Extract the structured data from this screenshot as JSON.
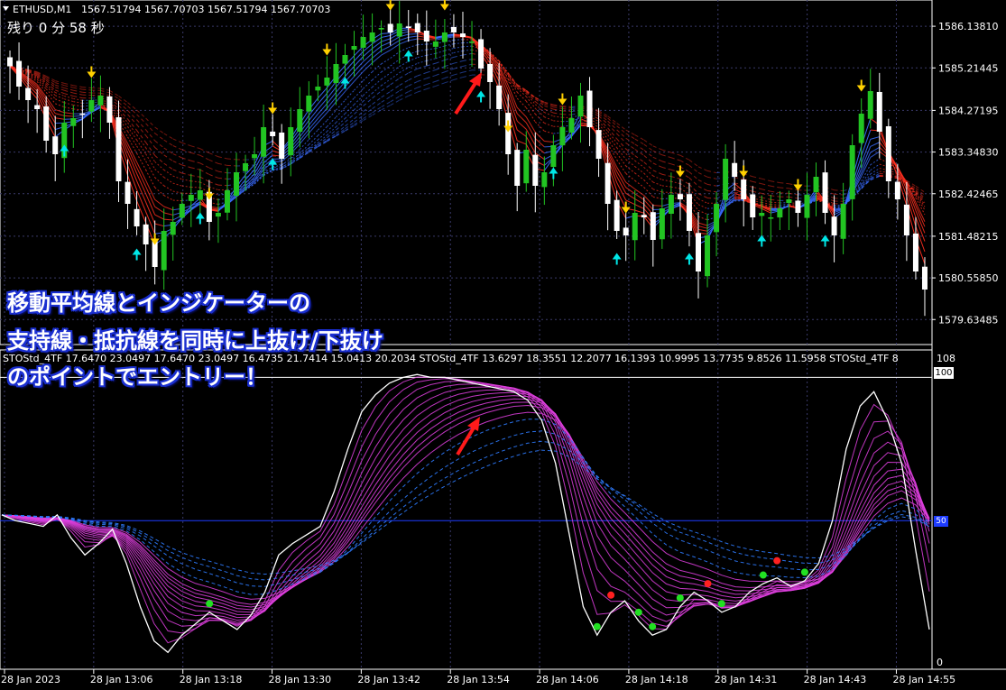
{
  "header": {
    "symbol": "ETHUSD,M1",
    "ohlc": "1567.51794 1567.70703 1567.51794 1567.70703",
    "timer_text": "残り 0 分 58 秒",
    "menu_arrow_icon": "triangle-down-icon"
  },
  "price_axis": {
    "labels": [
      "1586.13810",
      "1585.21445",
      "1584.27195",
      "1583.34830",
      "1582.42465",
      "1581.48215",
      "1580.55850",
      "1579.63485"
    ]
  },
  "indicator": {
    "header_text": "STOStd_4TF 17.6470 23.0497 17.6470 23.0497 16.4735 21.7414 15.0413 20.2034  STOStd_4TF 13.6297 18.3551 12.2077 16.1393 10.9995 13.7735 9.8526 11.5958  STOStd_4TF 8",
    "axis_top": "108",
    "level_100": "100",
    "level_mid": "50",
    "level_0": "0"
  },
  "time_axis": {
    "labels": [
      "28 Jan 2023",
      "28 Jan 13:06",
      "28 Jan 13:18",
      "28 Jan 13:30",
      "28 Jan 13:42",
      "28 Jan 13:54",
      "28 Jan 14:06",
      "28 Jan 14:18",
      "28 Jan 14:31",
      "28 Jan 14:43",
      "28 Jan 14:55"
    ]
  },
  "annotation": {
    "line1": "移動平均線とインジケーターの",
    "line2": "支持線・抵抗線を同時に上抜け/下抜け",
    "line3": "のポイントでエントリー！"
  },
  "colors": {
    "background": "#000000",
    "bull_candle": "#22c422",
    "bear_candle": "#ffffff",
    "ma_up": "#3a6cff",
    "ma_down": "#ff3020",
    "osc_main": "#ffffff",
    "osc_fan": "#e040e0",
    "buy_arrow": "#00e6e6",
    "sell_arrow": "#ffd000",
    "annotation_arrow": "#ff1a1a"
  },
  "chart_data": {
    "type": "candlestick",
    "symbol": "ETHUSD,M1",
    "x_labels": [
      "28 Jan 2023",
      "28 Jan 13:06",
      "28 Jan 13:18",
      "28 Jan 13:30",
      "28 Jan 13:42",
      "28 Jan 13:54",
      "28 Jan 14:06",
      "28 Jan 14:18",
      "28 Jan 14:31",
      "28 Jan 14:43",
      "28 Jan 14:55"
    ],
    "y_range_price": [
      1579.2,
      1586.6
    ],
    "close_prices": [
      1585.25,
      1584.8,
      1584.5,
      1584.3,
      1583.6,
      1583.3,
      1584.0,
      1584.1,
      1584.2,
      1584.5,
      1584.6,
      1584.0,
      1582.7,
      1582.2,
      1581.7,
      1581.3,
      1580.8,
      1581.6,
      1581.8,
      1582.2,
      1582.4,
      1582.5,
      1581.8,
      1582.0,
      1582.5,
      1582.9,
      1583.1,
      1583.3,
      1583.9,
      1583.7,
      1583.2,
      1583.9,
      1584.3,
      1584.6,
      1584.8,
      1585.0,
      1585.3,
      1585.5,
      1585.7,
      1585.9,
      1586.0,
      1586.1,
      1586.0,
      1586.2,
      1586.1,
      1586.0,
      1585.8,
      1585.8,
      1586.0,
      1586.0,
      1585.9,
      1585.8,
      1585.2,
      1584.9,
      1584.3,
      1583.3,
      1582.6,
      1583.4,
      1582.6,
      1582.9,
      1583.5,
      1583.9,
      1584.1,
      1584.6,
      1583.9,
      1583.2,
      1582.2,
      1581.6,
      1581.5,
      1582.0,
      1581.9,
      1581.4,
      1582.1,
      1582.4,
      1582.3,
      1581.6,
      1580.7,
      1581.5,
      1582.2,
      1583.2,
      1582.8,
      1582.3,
      1581.9,
      1582.0,
      1581.9,
      1582.1,
      1582.3,
      1582.0,
      1582.4,
      1582.8,
      1582.0,
      1581.5,
      1582.2,
      1583.5,
      1584.2,
      1584.7,
      1583.8,
      1582.7,
      1582.3,
      1581.5,
      1580.7,
      1580.3
    ],
    "oscillator_y_range": [
      0,
      108
    ],
    "oscillator_levels": [
      0,
      50,
      100
    ],
    "oscillator_main": [
      52,
      50,
      49,
      48,
      52,
      44,
      38,
      42,
      47,
      35,
      20,
      8,
      4,
      10,
      14,
      18,
      15,
      12,
      17,
      25,
      38,
      42,
      45,
      48,
      60,
      75,
      88,
      94,
      98,
      100,
      101,
      100,
      100,
      99,
      98,
      97,
      96,
      95,
      92,
      85,
      70,
      45,
      20,
      10,
      18,
      22,
      15,
      10,
      12,
      20,
      25,
      22,
      18,
      20,
      25,
      28,
      30,
      27,
      29,
      35,
      50,
      75,
      90,
      95,
      85,
      70,
      40,
      12
    ],
    "buy_signal_count": 12,
    "sell_signal_count": 14
  }
}
